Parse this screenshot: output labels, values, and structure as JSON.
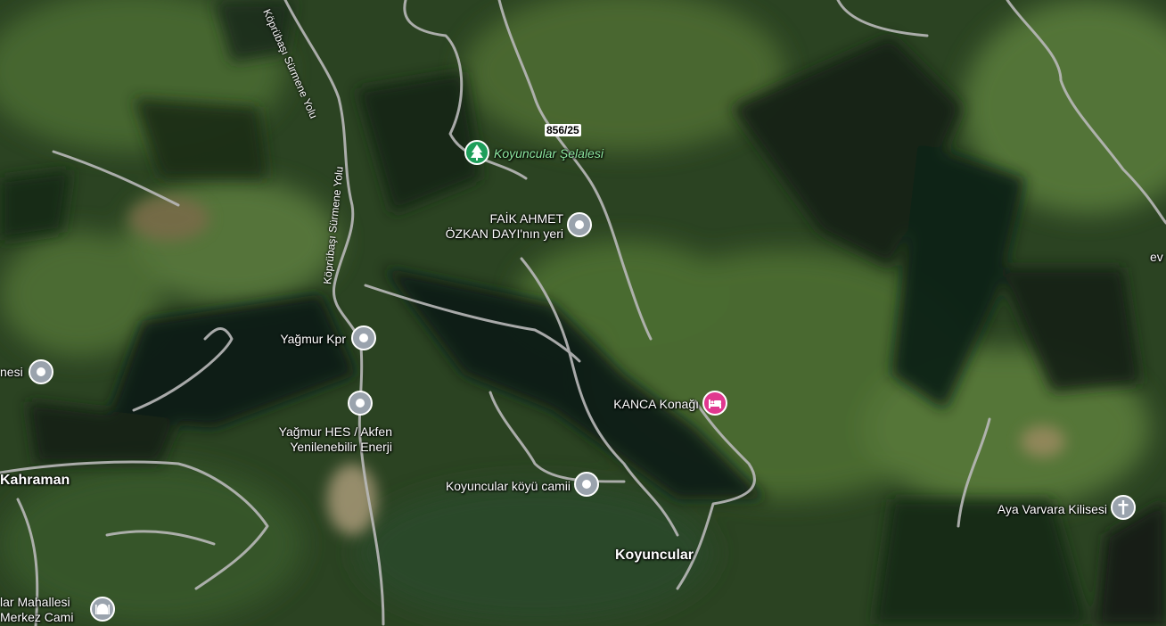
{
  "map": {
    "type": "satellite",
    "colors": {
      "forest_dark": "#1d2f18",
      "forest_mid": "#2f4a25",
      "forest_light": "#4e6e34",
      "shadow": "#0e1a12",
      "road": "#b9b9b9",
      "pin_gray": "#9aa3ad",
      "pin_green": "#1e9e5a",
      "pin_pink": "#e0388f"
    }
  },
  "road_badge": "856/25",
  "road_names": {
    "r1": "Köprübaşı Sürmene Yolu",
    "r2": "Köprübaşı Sürmene Yolu"
  },
  "places": [
    {
      "key": "koyuncular_selalesi",
      "label": "Koyuncular Şelalesi",
      "icon": "tree-icon"
    },
    {
      "key": "faik_ahmet",
      "label_line1": "FAİK AHMET",
      "label_line2": "ÖZKAN DAYI'nın yeri",
      "icon": "place-pin-icon"
    },
    {
      "key": "yagmur_kpr",
      "label": "Yağmur Kpr",
      "icon": "place-pin-icon"
    },
    {
      "key": "yagmur_hes",
      "label_line1": "Yağmur HES / Akfen",
      "label_line2": "Yenilenebilir Enerji",
      "icon": "place-pin-icon"
    },
    {
      "key": "kanca_konagi",
      "label": "KANCA Konağı",
      "icon": "hotel-bed-icon"
    },
    {
      "key": "koyuncular_koyu_camii",
      "label": "Koyuncular köyü camii",
      "icon": "place-pin-icon"
    },
    {
      "key": "koyuncular",
      "label": "Koyuncular"
    },
    {
      "key": "kahraman",
      "label": "Kahraman"
    },
    {
      "key": "mahallesi_merkez",
      "label_line1": "lar Mahallesi",
      "label_line2": "Merkez Cami",
      "icon": "mosque-icon"
    },
    {
      "key": "aya_varvara",
      "label": "Aya Varvara Kilisesi",
      "icon": "church-cross-icon"
    },
    {
      "key": "nesi",
      "label": "nesi",
      "icon": "place-pin-icon"
    },
    {
      "key": "ev",
      "label": "ev"
    }
  ]
}
